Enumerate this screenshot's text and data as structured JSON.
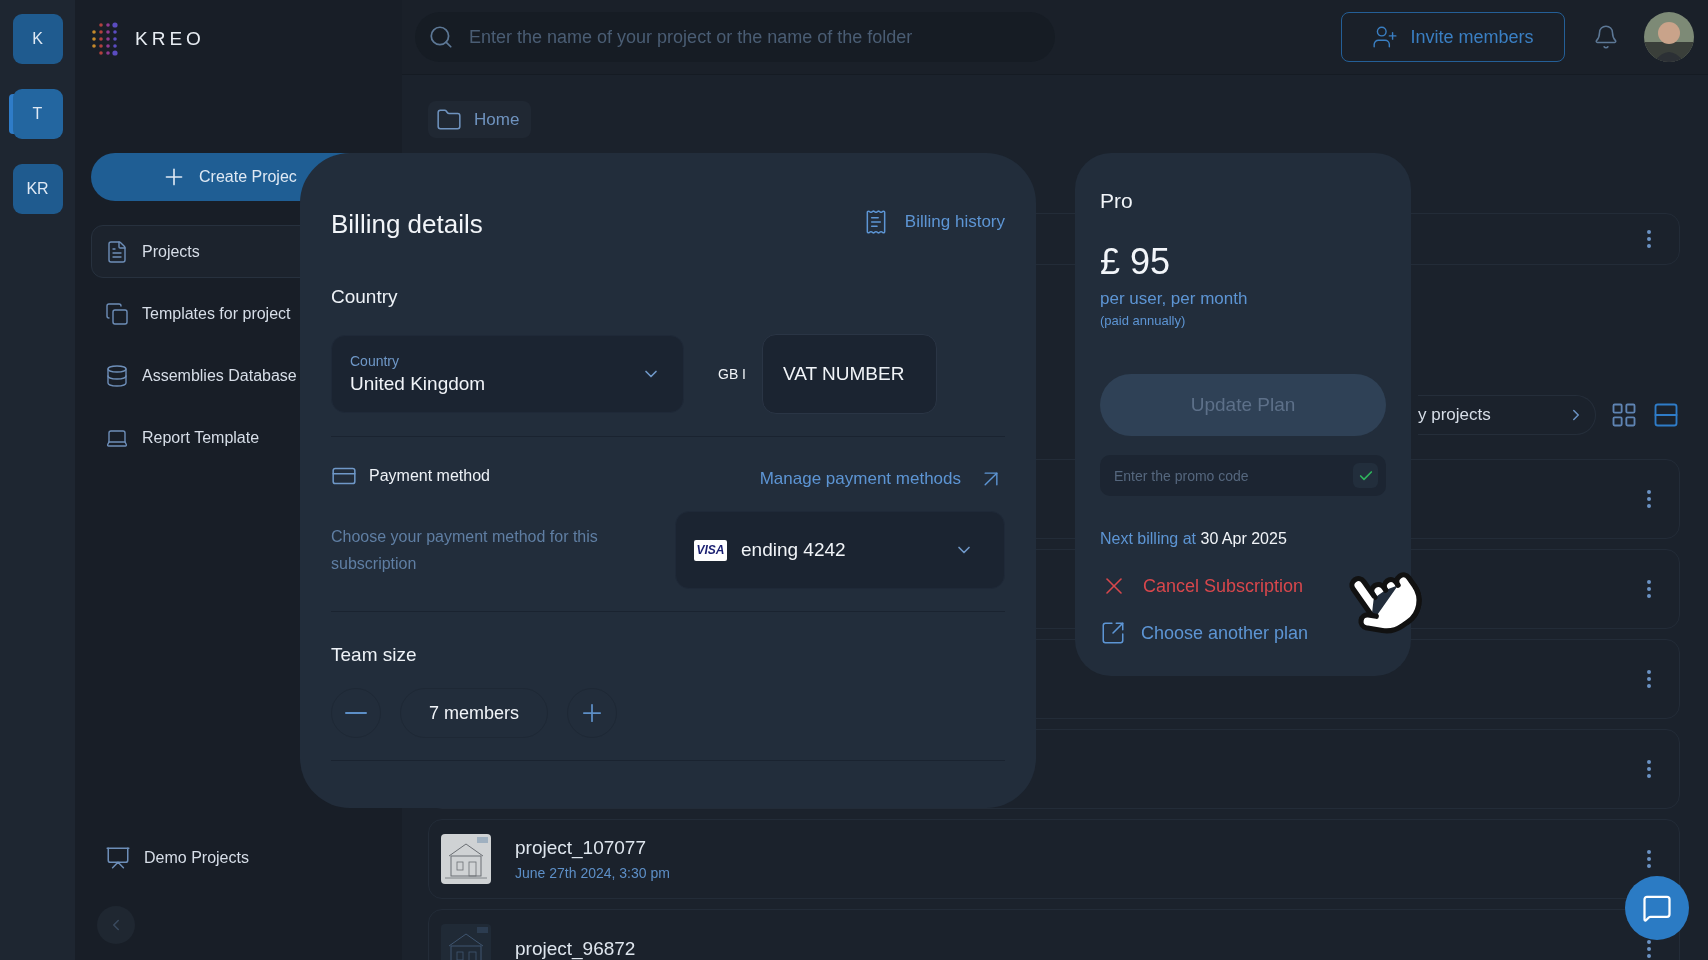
{
  "rail": {
    "workspaces": [
      {
        "label": "K",
        "selected": false
      },
      {
        "label": "T",
        "selected": true
      },
      {
        "label": "KR",
        "selected": false
      }
    ]
  },
  "brand": {
    "name": "KREO"
  },
  "sidebar": {
    "create_button": "Create Projec",
    "items": [
      {
        "label": "Projects",
        "selected": true
      },
      {
        "label": "Templates for project",
        "selected": false
      },
      {
        "label": "Assemblies Database",
        "selected": false
      },
      {
        "label": "Report Template",
        "selected": false
      }
    ],
    "footer_item": {
      "label": "Demo Projects"
    }
  },
  "topbar": {
    "search": {
      "placeholder": "Enter the name of your project or the name of the folder"
    },
    "invite_button": "Invite members"
  },
  "breadcrumb": {
    "label": "Home"
  },
  "projects": {
    "top_rows": [
      {
        "kind": "covered"
      }
    ],
    "filter": "y projects",
    "view_options": [
      {
        "kind": "grid",
        "selected": false
      },
      {
        "kind": "list",
        "selected": true
      }
    ],
    "rows": [
      {
        "kind": "covered"
      },
      {
        "kind": "covered"
      },
      {
        "kind": "covered"
      },
      {
        "kind": "covered"
      },
      {
        "kind": "project",
        "name": "project_107077",
        "date": "June 27th 2024, 3:30 pm"
      },
      {
        "kind": "project",
        "name": "project_96872"
      }
    ]
  },
  "billing": {
    "title": "Billing details",
    "history_link": "Billing history",
    "country_heading": "Country",
    "country_select": {
      "label": "Country",
      "value": "United Kingdom"
    },
    "vat_prefix": "GB I",
    "vat_field": {
      "placeholder": "VAT NUMBER"
    },
    "payment_heading": "Payment method",
    "manage_link": "Manage payment methods",
    "payment_hint": "Choose your payment method for this subscription",
    "card_select": {
      "brand": "VISA",
      "value": "ending 4242"
    },
    "team_heading": "Team size",
    "team_value": "7 members"
  },
  "plan": {
    "name": "Pro",
    "price": "£ 95",
    "period": "per user, per month",
    "billing_note": "(paid annually)",
    "update_button": {
      "label": "Update Plan",
      "disabled": true
    },
    "promo": {
      "placeholder": "Enter the promo code"
    },
    "next_billing": "Next billing at **30 Apr 2025**",
    "actions": [
      {
        "kind": "cancel",
        "label": "Cancel Subscription"
      },
      {
        "kind": "change",
        "label": "Choose another plan"
      }
    ]
  }
}
